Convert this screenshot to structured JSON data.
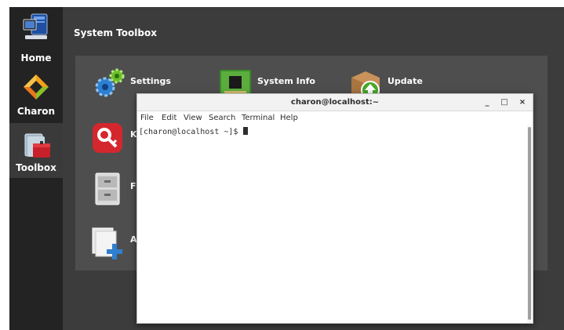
{
  "nav": {
    "items": [
      {
        "label": "Home",
        "icon": "computer-icon"
      },
      {
        "label": "Charon",
        "icon": "charon-logo-icon"
      },
      {
        "label": "Toolbox",
        "icon": "toolbox-icon"
      }
    ],
    "active": "Toolbox"
  },
  "main": {
    "title": "System Toolbox",
    "tools": [
      {
        "label": "Settings",
        "icon": "gears-icon"
      },
      {
        "label": "System Info",
        "icon": "chip-icon"
      },
      {
        "label": "Update",
        "icon": "update-box-icon"
      },
      {
        "label": "K",
        "icon": "key-icon"
      },
      {
        "label": "F",
        "icon": "file-cabinet-icon"
      },
      {
        "label": "A",
        "icon": "add-document-icon"
      }
    ]
  },
  "terminal": {
    "title": "charon@localhost:~",
    "menu": [
      "File",
      "Edit",
      "View",
      "Search",
      "Terminal",
      "Help"
    ],
    "prompt": "[charon@localhost ~]$ ",
    "controls": {
      "minimize": "_",
      "maximize": "□",
      "close": "×"
    }
  },
  "colors": {
    "background": "#3c3c3c",
    "nav_background": "#232323",
    "panel": "#4e4e4e",
    "terminal_bg": "#ffffff"
  }
}
